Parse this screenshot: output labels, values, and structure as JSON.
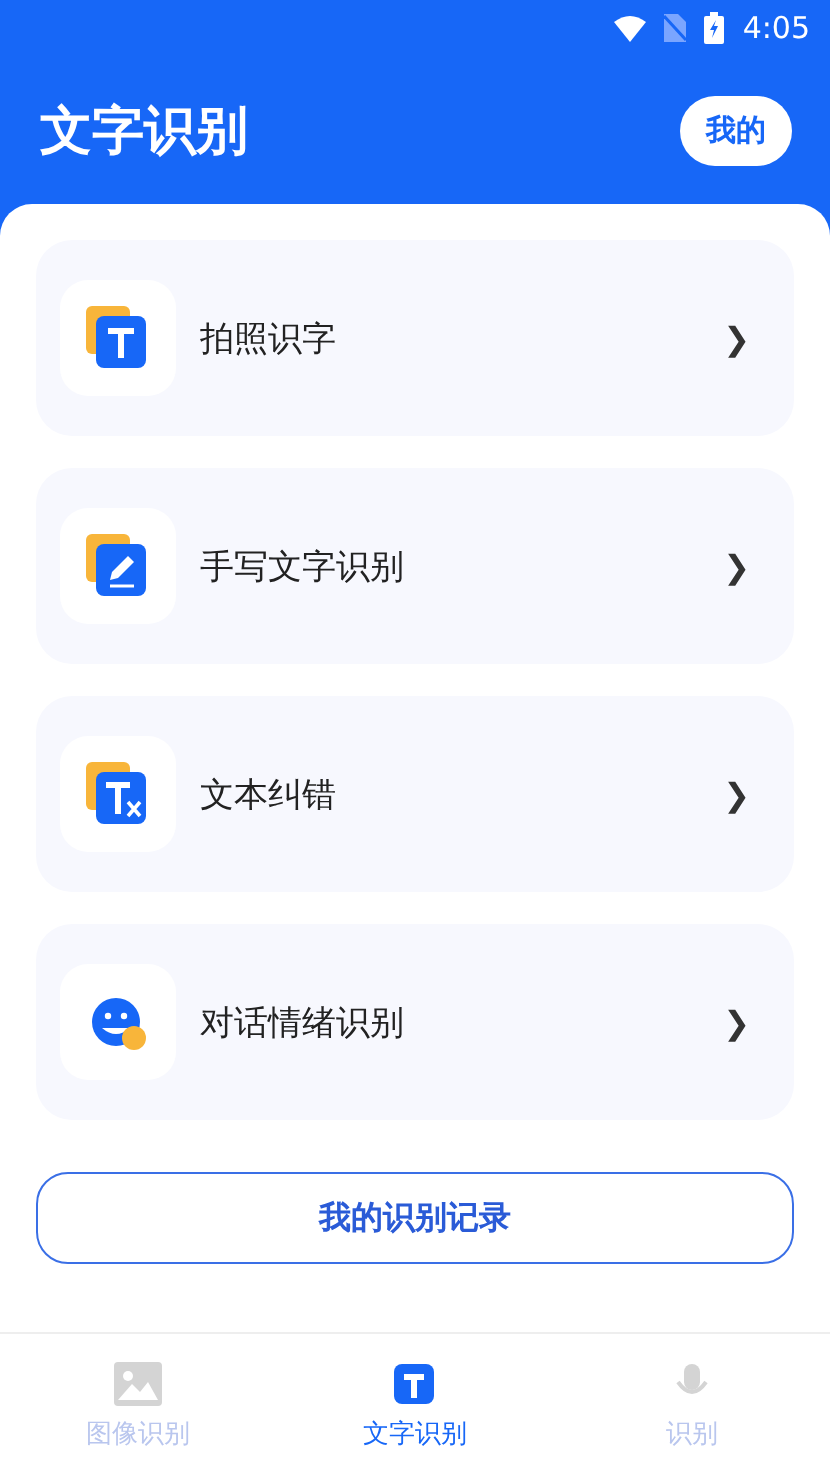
{
  "status_bar": {
    "time": "4:05"
  },
  "header": {
    "title": "文字识别",
    "button": "我的"
  },
  "features": [
    {
      "kind": "photo",
      "label": "拍照识字",
      "chevron": "❯"
    },
    {
      "kind": "handwriting",
      "label": "手写文字识别",
      "chevron": "❯"
    },
    {
      "kind": "correction",
      "label": "文本纠错",
      "chevron": "❯"
    },
    {
      "kind": "emotion",
      "label": "对话情绪识别",
      "chevron": "❯"
    }
  ],
  "records_button": "我的识别记录",
  "bottom_nav": [
    {
      "kind": "image",
      "label": "图像识别",
      "selected": false
    },
    {
      "kind": "text",
      "label": "文字识别",
      "selected": true
    },
    {
      "kind": "voice",
      "label": "识别",
      "selected": false
    }
  ]
}
